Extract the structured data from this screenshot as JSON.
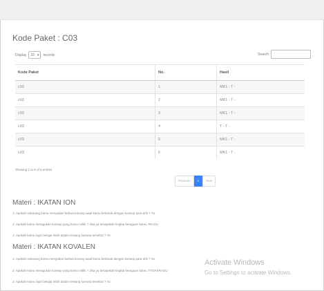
{
  "page": {
    "title": "Kode Paket : C03"
  },
  "table_controls": {
    "display_label": "Display",
    "entries_value": "10",
    "records_label": "records",
    "search_label": "Search:"
  },
  "table": {
    "headers": [
      "Kode Paket",
      "No.",
      "Hasil"
    ],
    "rows": [
      [
        "c03",
        "1",
        "MK1 - T -"
      ],
      [
        "c03",
        "2",
        "MK1 - T -"
      ],
      [
        "c03",
        "3",
        "MK1 - T -"
      ],
      [
        "c03",
        "4",
        "T - T -"
      ],
      [
        "c03",
        "5",
        "MK1 - T -"
      ],
      [
        "c03",
        "6",
        "MK1 - T -"
      ]
    ]
  },
  "footer": {
    "showing": "Showing 1 to 6 of 6 entries"
  },
  "pagination": {
    "previous": "Previous",
    "current": "1",
    "next": "Next"
  },
  "materi": [
    {
      "title": "Materi : IKATAN ION",
      "questions": [
        "1. Apakah sebarang kamu menyadari bahwa konsep awal kamu berbeda dengan konsep para ahli ? Ya",
        "2. Apakah kamu meragukan konsep yang kamu miliki ? Jika ya berapakah tingkat keraguan kamu ?RAGU",
        "3. Apakah kamu ingin belajar lebih dalam tentang konsep tersebut ? Ya"
      ]
    },
    {
      "title": "Materi : IKATAN KOVALEN",
      "questions": [
        "1. Apakah sekarang kamu menyadari bahwa konsep awal kamu berbeda dengan konsep para ahli ? Ya",
        "2. Apakah kamu meragukan konsep yang kamu miliki ? Jika ya berapakah tingkat keraguan kamu ?TIDAKRAGU",
        "3. Apakah kamu ingin belajar lebih dalam tentang konsep tersebut ? Ya"
      ]
    }
  ],
  "watermark": {
    "title": "Activate Windows",
    "subtitle": "Go to Settings to activate Windows."
  }
}
